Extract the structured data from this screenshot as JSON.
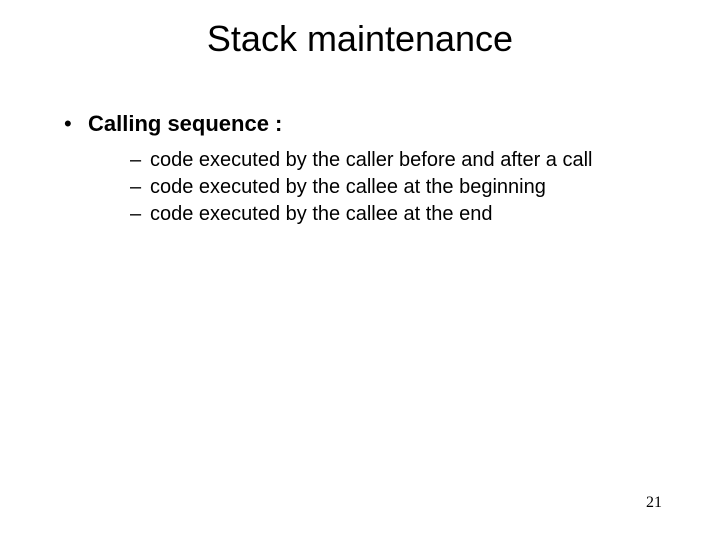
{
  "title": "Stack maintenance",
  "l1": "Calling sequence :",
  "sub": [
    "code executed by the caller before and after a call",
    "code executed by the callee at the beginning",
    "code executed by the callee at the end"
  ],
  "page": "21"
}
